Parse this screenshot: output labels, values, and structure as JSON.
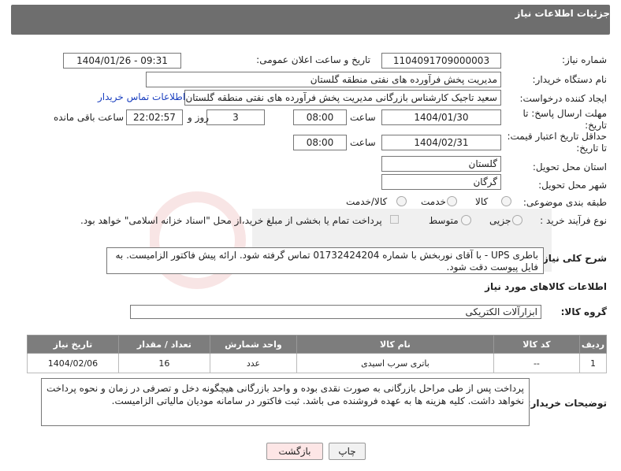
{
  "page": {
    "title": "جزئیات اطلاعات نیاز"
  },
  "fields": {
    "need_number_label": "شماره نیاز:",
    "need_number": "1104091709000003",
    "announce_label": "تاریخ و ساعت اعلان عمومی:",
    "announce_value": "1404/01/26 - 09:31",
    "buyer_org_label": "نام دستگاه خریدار:",
    "buyer_org": "مدیریت پخش فرآورده های نفتی منطقه گلستان",
    "requester_label": "ایجاد کننده درخواست:",
    "requester": "سعید تاجیک کارشناس بازرگانی مدیریت پخش فرآورده های نفتی منطقه گلستان",
    "contact_link": "اطلاعات تماس خریدار",
    "deadline_label": "مهلت ارسال پاسخ: تا تاریخ:",
    "deadline_date": "1404/01/30",
    "time_label": "ساعت",
    "deadline_time": "08:00",
    "days_count": "3",
    "days_label": "روز و",
    "remaining_time": "22:02:57",
    "remaining_label": "ساعت باقی مانده",
    "validity_label": "حداقل تاریخ اعتبار قیمت: تا تاریخ:",
    "validity_date": "1404/02/31",
    "validity_time": "08:00",
    "province_label": "استان محل تحویل:",
    "province": "گلستان",
    "city_label": "شهر محل تحویل:",
    "city": "گرگان",
    "category_label": "طبقه بندی موضوعی:",
    "category_options": [
      "کالا",
      "خدمت",
      "کالا/خدمت"
    ],
    "process_label": "نوع فرآیند خرید :",
    "process_options": [
      "جزیی",
      "متوسط"
    ],
    "payment_note": "پرداخت تمام یا بخشی از مبلغ خرید،از محل \"اسناد خزانه اسلامی\" خواهد بود."
  },
  "description": {
    "label": "شرح کلی نیاز:",
    "text": "باطری UPS - با آقای نوربخش با شماره 01732424204 تماس گرفته شود. ارائه پیش فاکتور الزامیست. به فایل پیوست دقت شود."
  },
  "goods": {
    "section_title": "اطلاعات کالاهای مورد نیاز",
    "group_label": "گروه کالا:",
    "group_value": "ابزارآلات الکتریکی",
    "headers": [
      "ردیف",
      "کد کالا",
      "نام کالا",
      "واحد شمارش",
      "تعداد / مقدار",
      "تاریخ نیاز"
    ],
    "rows": [
      {
        "row": "1",
        "code": "--",
        "name": "باتری سرب اسیدی",
        "unit": "عدد",
        "qty": "16",
        "date": "1404/02/06"
      }
    ]
  },
  "buyer_notes": {
    "label": "توضیحات خریدار:",
    "text": "پرداخت پس از طی مراحل بازرگانی به صورت نقدی بوده و واحد بازرگانی هیچگونه دخل و تصرفی در زمان و نحوه پرداخت نخواهد داشت. کلیه هزینه ها به عهده فروشنده می باشد. ثبت فاکتور در سامانه مودیان مالیاتی الزامیست."
  },
  "buttons": {
    "print": "چاپ",
    "back": "بازگشت"
  }
}
